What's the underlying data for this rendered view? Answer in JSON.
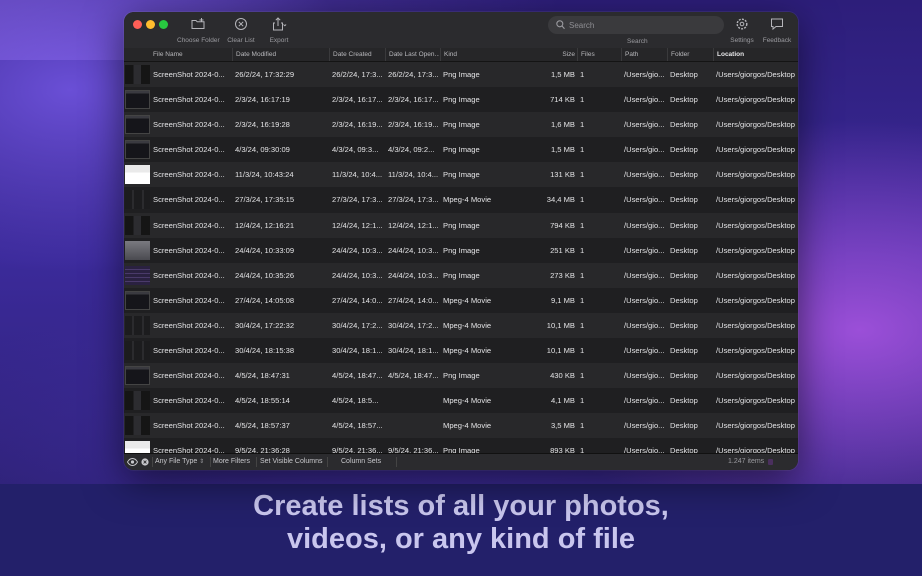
{
  "caption": {
    "line1": "Create lists of all your photos,",
    "line2": "videos, or any kind of file"
  },
  "toolbar": {
    "choose_folder": "Choose Folder",
    "clear_list": "Clear List",
    "export": "Export",
    "search_placeholder": "Search",
    "search_label": "Search",
    "settings": "Settings",
    "feedback": "Feedback"
  },
  "columns": {
    "file_name": "File Name",
    "date_modified": "Date Modified",
    "date_created": "Date Created",
    "date_last_opened": "Date Last Open...",
    "kind": "Kind",
    "size": "Size",
    "files": "Files",
    "path": "Path",
    "folder": "Folder",
    "location": "Location"
  },
  "rows": [
    {
      "name": "ScreenShot 2024-0...",
      "modified": "26/2/24, 17:32:29",
      "created": "26/2/24, 17:3...",
      "opened": "26/2/24, 17:3...",
      "kind": "Png Image",
      "size": "1,5 MB",
      "files": "1",
      "path": "/Users/gio...",
      "folder": "Desktop",
      "location": "/Users/giorgos/Desktop",
      "thumb": "dark-vertical"
    },
    {
      "name": "ScreenShot 2024-0...",
      "modified": "2/3/24, 16:17:19",
      "created": "2/3/24, 16:17...",
      "opened": "2/3/24, 16:17...",
      "kind": "Png Image",
      "size": "714 KB",
      "files": "1",
      "path": "/Users/gio...",
      "folder": "Desktop",
      "location": "/Users/giorgos/Desktop",
      "thumb": "dark-window"
    },
    {
      "name": "ScreenShot 2024-0...",
      "modified": "2/3/24, 16:19:28",
      "created": "2/3/24, 16:19...",
      "opened": "2/3/24, 16:19...",
      "kind": "Png Image",
      "size": "1,6 MB",
      "files": "1",
      "path": "/Users/gio...",
      "folder": "Desktop",
      "location": "/Users/giorgos/Desktop",
      "thumb": "dark-window"
    },
    {
      "name": "ScreenShot 2024-0...",
      "modified": "4/3/24, 09:30:09",
      "created": "4/3/24, 09:3...",
      "opened": "4/3/24, 09:2...",
      "kind": "Png Image",
      "size": "1,5 MB",
      "files": "1",
      "path": "/Users/gio...",
      "folder": "Desktop",
      "location": "/Users/giorgos/Desktop",
      "thumb": "dark-window"
    },
    {
      "name": "ScreenShot 2024-0...",
      "modified": "11/3/24, 10:43:24",
      "created": "11/3/24, 10:4...",
      "opened": "11/3/24, 10:4...",
      "kind": "Png Image",
      "size": "131 KB",
      "files": "1",
      "path": "/Users/gio...",
      "folder": "Desktop",
      "location": "/Users/giorgos/Desktop",
      "thumb": "light-doc"
    },
    {
      "name": "ScreenShot 2024-0...",
      "modified": "27/3/24, 17:35:15",
      "created": "27/3/24, 17:3...",
      "opened": "27/3/24, 17:3...",
      "kind": "Mpeg-4 Movie",
      "size": "34,4 MB",
      "files": "1",
      "path": "/Users/gio...",
      "folder": "Desktop",
      "location": "/Users/giorgos/Desktop",
      "thumb": "dark-split"
    },
    {
      "name": "ScreenShot 2024-0...",
      "modified": "12/4/24, 12:16:21",
      "created": "12/4/24, 12:1...",
      "opened": "12/4/24, 12:1...",
      "kind": "Png Image",
      "size": "794 KB",
      "files": "1",
      "path": "/Users/gio...",
      "folder": "Desktop",
      "location": "/Users/giorgos/Desktop",
      "thumb": "dark-vertical"
    },
    {
      "name": "ScreenShot 2024-0...",
      "modified": "24/4/24, 10:33:09",
      "created": "24/4/24, 10:3...",
      "opened": "24/4/24, 10:3...",
      "kind": "Png Image",
      "size": "251 KB",
      "files": "1",
      "path": "/Users/gio...",
      "folder": "Desktop",
      "location": "/Users/giorgos/Desktop",
      "thumb": "grey-doc"
    },
    {
      "name": "ScreenShot 2024-0...",
      "modified": "24/4/24, 10:35:26",
      "created": "24/4/24, 10:3...",
      "opened": "24/4/24, 10:3...",
      "kind": "Png Image",
      "size": "273 KB",
      "files": "1",
      "path": "/Users/gio...",
      "folder": "Desktop",
      "location": "/Users/giorgos/Desktop",
      "thumb": "purple-list"
    },
    {
      "name": "ScreenShot 2024-0...",
      "modified": "27/4/24, 14:05:08",
      "created": "27/4/24, 14:0...",
      "opened": "27/4/24, 14:0...",
      "kind": "Mpeg-4 Movie",
      "size": "9,1 MB",
      "files": "1",
      "path": "/Users/gio...",
      "folder": "Desktop",
      "location": "/Users/giorgos/Desktop",
      "thumb": "dark-window"
    },
    {
      "name": "ScreenShot 2024-0...",
      "modified": "30/4/24, 17:22:32",
      "created": "30/4/24, 17:2...",
      "opened": "30/4/24, 17:2...",
      "kind": "Mpeg-4 Movie",
      "size": "10,1 MB",
      "files": "1",
      "path": "/Users/gio...",
      "folder": "Desktop",
      "location": "/Users/giorgos/Desktop",
      "thumb": "dark-split"
    },
    {
      "name": "ScreenShot 2024-0...",
      "modified": "30/4/24, 18:15:38",
      "created": "30/4/24, 18:1...",
      "opened": "30/4/24, 18:1...",
      "kind": "Mpeg-4 Movie",
      "size": "10,1 MB",
      "files": "1",
      "path": "/Users/gio...",
      "folder": "Desktop",
      "location": "/Users/giorgos/Desktop",
      "thumb": "dark-split"
    },
    {
      "name": "ScreenShot 2024-0...",
      "modified": "4/5/24, 18:47:31",
      "created": "4/5/24, 18:47...",
      "opened": "4/5/24, 18:47...",
      "kind": "Png Image",
      "size": "430 KB",
      "files": "1",
      "path": "/Users/gio...",
      "folder": "Desktop",
      "location": "/Users/giorgos/Desktop",
      "thumb": "dark-window"
    },
    {
      "name": "ScreenShot 2024-0...",
      "modified": "4/5/24, 18:55:14",
      "created": "4/5/24, 18:5...",
      "opened": "",
      "kind": "Mpeg-4 Movie",
      "size": "4,1 MB",
      "files": "1",
      "path": "/Users/gio...",
      "folder": "Desktop",
      "location": "/Users/giorgos/Desktop",
      "thumb": "dark-vertical"
    },
    {
      "name": "ScreenShot 2024-0...",
      "modified": "4/5/24, 18:57:37",
      "created": "4/5/24, 18:57...",
      "opened": "",
      "kind": "Mpeg-4 Movie",
      "size": "3,5 MB",
      "files": "1",
      "path": "/Users/gio...",
      "folder": "Desktop",
      "location": "/Users/giorgos/Desktop",
      "thumb": "dark-vertical"
    },
    {
      "name": "ScreenShot 2024-0...",
      "modified": "9/5/24, 21:36:28",
      "created": "9/5/24, 21:36...",
      "opened": "9/5/24, 21:36...",
      "kind": "Png Image",
      "size": "893 KB",
      "files": "1",
      "path": "/Users/gio...",
      "folder": "Desktop",
      "location": "/Users/giorgos/Desktop",
      "thumb": "light-doc"
    }
  ],
  "statusbar": {
    "file_type": "Any File Type",
    "more_filters": "More Filters",
    "set_visible_columns": "Set Visible Columns",
    "column_sets": "Column Sets",
    "item_count": "1.247 items"
  },
  "colors": {
    "red": "#fe5f57",
    "yellow": "#febc2e",
    "green": "#28c840"
  }
}
